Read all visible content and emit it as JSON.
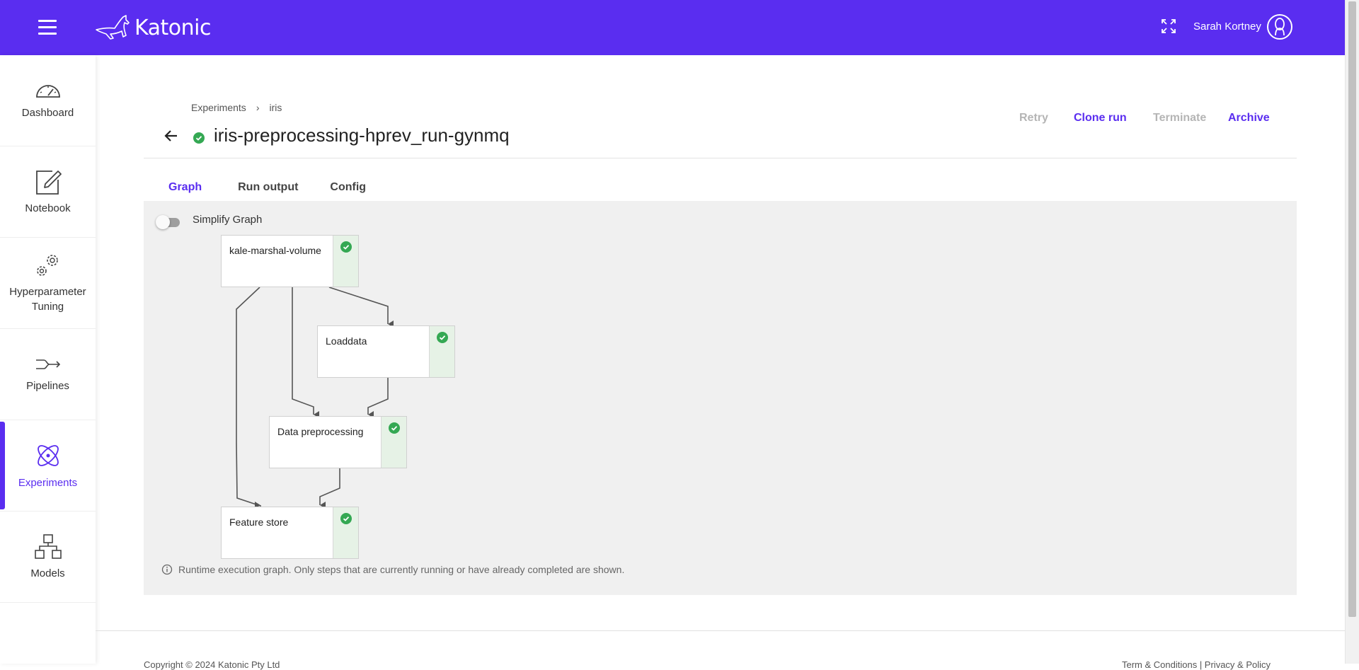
{
  "header": {
    "logo_text": "Katonic",
    "user_name": "Sarah Kortney",
    "brand_color": "#5a2df0",
    "icons": [
      "menu-icon",
      "kangaroo-logo-icon",
      "fullscreen-icon",
      "user-avatar-icon"
    ]
  },
  "sidebar": {
    "items": [
      {
        "label": "Dashboard",
        "icon": "gauge-icon"
      },
      {
        "label": "Notebook",
        "icon": "edit-icon"
      },
      {
        "label": "Hyperparameter Tuning",
        "icon": "gears-icon"
      },
      {
        "label": "Pipelines",
        "icon": "pipeline-icon"
      },
      {
        "label": "Experiments",
        "icon": "atom-icon",
        "active": true
      },
      {
        "label": "Models",
        "icon": "models-icon"
      }
    ]
  },
  "breadcrumb": {
    "items": [
      "Experiments",
      "iris"
    ],
    "separator": "›"
  },
  "run": {
    "title": "iris-preprocessing-hprev_run-gynmq",
    "status": "success",
    "status_color": "#34a853"
  },
  "actions": {
    "retry": "Retry",
    "clone_run": "Clone run",
    "terminate": "Terminate",
    "archive": "Archive"
  },
  "tabs": [
    "Graph",
    "Run output",
    "Config"
  ],
  "active_tab": "Graph",
  "graph": {
    "simplify_label": "Simplify Graph",
    "simplify_on": false,
    "nodes": [
      {
        "label": "kale-marshal-volume",
        "status": "success"
      },
      {
        "label": "Loaddata",
        "status": "success"
      },
      {
        "label": "Data preprocessing",
        "status": "success"
      },
      {
        "label": "Feature store",
        "status": "success"
      }
    ],
    "footnote": "Runtime execution graph. Only steps that are currently running or have already completed are shown."
  },
  "footer": {
    "copyright": "Copyright © 2024 Katonic Pty Ltd",
    "links": "Term & Conditions | Privacy & Policy"
  }
}
